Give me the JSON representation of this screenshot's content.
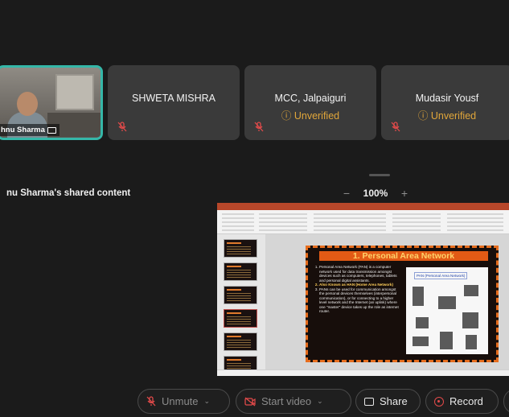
{
  "participants": [
    {
      "name": "hnu Sharma",
      "type": "video"
    },
    {
      "name": "SHWETA MISHRA",
      "status": ""
    },
    {
      "name": "MCC, Jalpaiguri",
      "status": "Unverified"
    },
    {
      "name": "Mudasir Yousf",
      "status": "Unverified"
    }
  ],
  "shared": {
    "title": "nu Sharma's shared content",
    "zoom": "100%",
    "zoom_out": "−",
    "zoom_in": "+"
  },
  "slide": {
    "title": "1. Personal Area Network",
    "bullets": [
      "Personal Area Network (PAN) is a computer network used for data transmission amongst devices such as computers, telephones, tablets and personal digital assistants.",
      "Also Known as HAN (Home Area Network)",
      "PANs can be used for communication amongst the personal devices themselves (interpersonal communication), or for connecting to a higher level network and the Internet (an uplink) where one \"master\" device takes up the role as internet router."
    ],
    "image_caption": "PAN (Personal Area Network)"
  },
  "toolbar": {
    "unmute": "Unmute",
    "start_video": "Start video",
    "share": "Share",
    "record": "Record"
  },
  "colors": {
    "active_speaker": "#35b7a8",
    "unverified": "#e0a63a",
    "muted_icon": "#e24a4a",
    "slide_accent": "#e25a15"
  }
}
